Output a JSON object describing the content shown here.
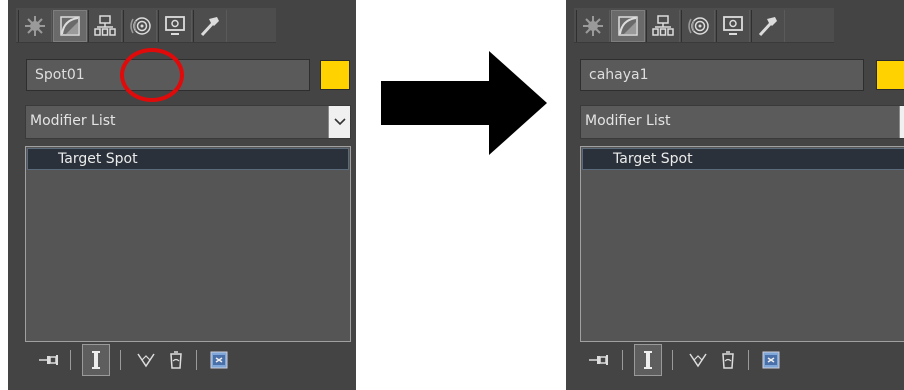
{
  "panels": {
    "left": {
      "object_name": "Spot01",
      "modifier_label": "Modifier List",
      "stack_item": "Target Spot"
    },
    "right": {
      "object_name": "cahaya1",
      "modifier_label": "Modifier List",
      "stack_item": "Target Spot"
    }
  },
  "toolbar_tabs": [
    "create-icon",
    "modify-icon",
    "hierarchy-icon",
    "motion-icon",
    "display-icon",
    "utilities-icon"
  ],
  "bottom_tools": [
    "pin-stack-icon",
    "show-end-result-icon",
    "make-unique-icon",
    "remove-modifier-icon",
    "configure-sets-icon"
  ],
  "colors": {
    "panel_bg": "#444444",
    "swatch": "#ffd200",
    "annotation": "#e10a0a",
    "arrow": "#000000"
  }
}
